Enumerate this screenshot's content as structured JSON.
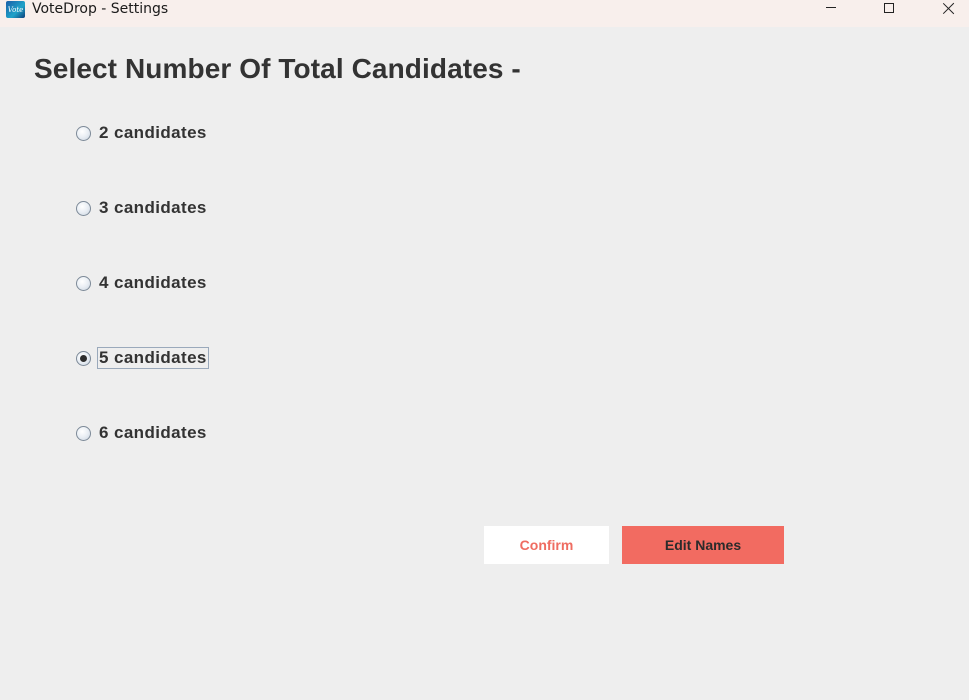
{
  "window": {
    "title": "VoteDrop - Settings",
    "icon": "votedrop-app-icon",
    "controls": [
      "minimize-icon",
      "maximize-icon",
      "close-icon"
    ]
  },
  "main": {
    "heading": "Select Number Of Total Candidates -",
    "options": [
      {
        "label": "2 candidates",
        "selected": false
      },
      {
        "label": "3 candidates",
        "selected": false
      },
      {
        "label": "4 candidates",
        "selected": false
      },
      {
        "label": "5 candidates",
        "selected": true
      },
      {
        "label": "6 candidates",
        "selected": false
      }
    ],
    "buttons": {
      "confirm_label": "Confirm",
      "edit_names_label": "Edit Names"
    }
  },
  "colors": {
    "accent": "#f26b61",
    "background": "#eeeeee",
    "titlebar": "#f8efec",
    "text": "#333333"
  }
}
